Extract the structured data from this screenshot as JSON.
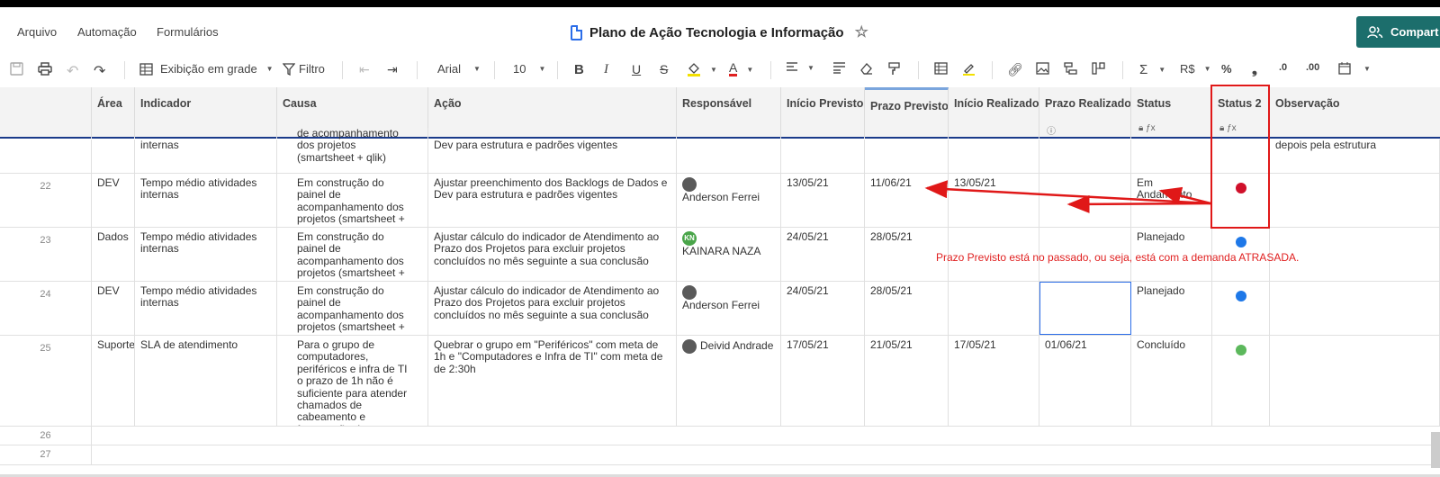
{
  "menu": [
    "Arquivo",
    "Automação",
    "Formulários"
  ],
  "title": "Plano de Ação Tecnologia e Informação",
  "share_label": "Compart",
  "toolbar": {
    "view_label": "Exibição em grade",
    "filter_label": "Filtro",
    "font": "Arial",
    "font_size": "10",
    "currency": "R$",
    "percent": "%",
    "decimal_dec": ".0",
    "decimal_inc": ".00"
  },
  "columns": [
    "Área",
    "Indicador",
    "Causa",
    "Ação",
    "Responsável",
    "Início Previsto",
    "Prazo Previsto",
    "Início Realizado",
    "Prazo Realizado",
    "Status",
    "Status 2",
    "Observação"
  ],
  "partial_row": {
    "indicador": "internas",
    "causa": "de acompanhamento dos projetos (smartsheet + qlik)",
    "acao": "Dev para estrutura e padrões vigentes",
    "observacao": "depois pela estrutura"
  },
  "rows": [
    {
      "num": "22",
      "area": "DEV",
      "indicador": "Tempo médio atividades internas",
      "causa": "Em construção do painel de acompanhamento dos projetos (smartsheet + qlik)",
      "acao": "Ajustar preenchimento dos Backlogs de Dados e Dev para estrutura e padrões vigentes",
      "responsavel": "Anderson Ferrei",
      "inicio_prev": "13/05/21",
      "prazo_prev": "11/06/21",
      "inicio_real": "13/05/21",
      "prazo_real": "",
      "status": "Em Andamento",
      "status2": "red"
    },
    {
      "num": "23",
      "area": "Dados",
      "indicador": "Tempo médio atividades internas",
      "causa": "Em construção do painel de acompanhamento dos projetos (smartsheet + qlik)",
      "acao": "Ajustar cálculo do indicador de Atendimento ao Prazo dos Projetos para excluir projetos concluídos no mês seguinte a sua conclusão",
      "responsavel": "KAINARA NAZA",
      "inicio_prev": "24/05/21",
      "prazo_prev": "28/05/21",
      "inicio_real": "",
      "prazo_real": "",
      "status": "Planejado",
      "status2": "blue"
    },
    {
      "num": "24",
      "area": "DEV",
      "indicador": "Tempo médio atividades internas",
      "causa": "Em construção do painel de acompanhamento dos projetos (smartsheet + qlik)",
      "acao": "Ajustar cálculo do indicador de Atendimento ao Prazo dos Projetos para excluir projetos concluídos no mês seguinte a sua conclusão",
      "responsavel": "Anderson Ferrei",
      "inicio_prev": "24/05/21",
      "prazo_prev": "28/05/21",
      "inicio_real": "",
      "prazo_real": "",
      "status": "Planejado",
      "status2": "blue"
    },
    {
      "num": "25",
      "area": "Suporte",
      "indicador": "SLA de atendimento",
      "causa": "Para o grupo de computadores, periféricos e infra de TI o prazo de 1h não é suficiente para atender chamados de cabeamento e formatação de computadores",
      "acao": "Quebrar o grupo em \"Periféricos\" com meta de 1h e \"Computadores e Infra de TI\" com meta de de 2:30h",
      "responsavel": "Deivid Andrade",
      "inicio_prev": "17/05/21",
      "prazo_prev": "21/05/21",
      "inicio_real": "17/05/21",
      "prazo_real": "01/06/21",
      "status": "Concluído",
      "status2": "green"
    }
  ],
  "empty_rows": [
    "26",
    "27"
  ],
  "avatar_initials": "KN",
  "annotation": "Prazo Previsto está no passado, ou seja, está com a demanda ATRASADA.",
  "colors": {
    "red": "#d0102a",
    "blue": "#1e78e8",
    "green": "#5cb85c",
    "share": "#1c6e6c"
  }
}
